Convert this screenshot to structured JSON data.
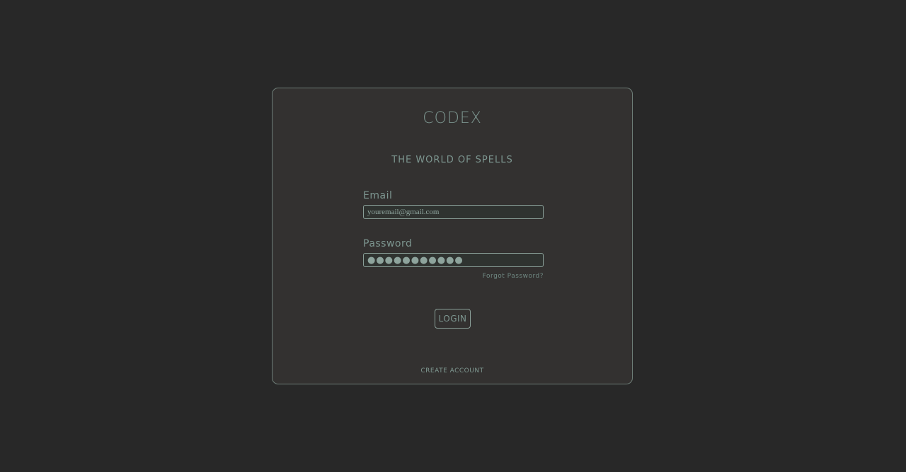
{
  "app": {
    "title": "CODEX",
    "subtitle": "THE WORLD OF SPELLS"
  },
  "form": {
    "email_label": "Email",
    "email_value": "youremail@gmail.com",
    "password_label": "Password",
    "password_value": "●●●●●●●●●●●",
    "forgot_label": "Forgot Password?",
    "login_label": "LOGIN",
    "create_account_label": "CREATE ACCOUNT"
  },
  "colors": {
    "background": "#282828",
    "card": "#333130",
    "accent": "#7d9690"
  }
}
